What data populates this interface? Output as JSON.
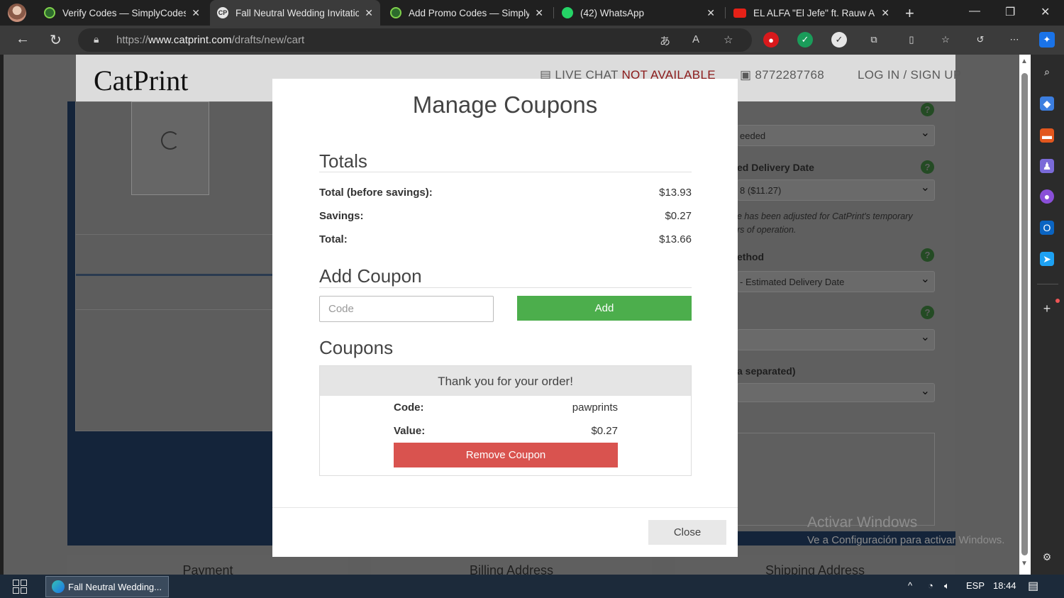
{
  "tabs": [
    {
      "title": "Verify Codes — SimplyCodes",
      "icon": "simplycodes-icon"
    },
    {
      "title": "Fall Neutral Wedding Invitatio",
      "icon": "catprint-icon"
    },
    {
      "title": "Add Promo Codes — SimplyC",
      "icon": "simplycodes-icon"
    },
    {
      "title": "(42) WhatsApp",
      "icon": "whatsapp-icon"
    },
    {
      "title": "EL ALFA \"El Jefe\" ft. Rauw Ale",
      "icon": "youtube-icon"
    }
  ],
  "address": {
    "prefix": "https://",
    "domain": "www.catprint.com",
    "path": "/drafts/new/cart"
  },
  "site": {
    "logo": "CatPrint",
    "live_chat": "LIVE CHAT",
    "not_available": "NOT AVAILABLE",
    "phone": "8772287768",
    "login": "LOG IN / SIGN UP"
  },
  "background_form": {
    "select1": "eeded",
    "label_delivery": "ed Delivery Date",
    "select2": "8 ($11.27)",
    "note_line1": "e has been adjusted for CatPrint's temporary",
    "note_line2": "rs of operation.",
    "label_method": "ethod",
    "select3": "- Estimated Delivery Date",
    "label_separated": "a separated)",
    "bottom_payment": "Payment",
    "bottom_billing": "Billing Address",
    "bottom_shipping": "Shipping Address"
  },
  "watermark": {
    "line1": "Activar Windows",
    "line2": "Ve a Configuración para activar Windows."
  },
  "modal": {
    "title": "Manage Coupons",
    "totals_heading": "Totals",
    "totals": [
      {
        "label": "Total (before savings):",
        "value": "$13.93"
      },
      {
        "label": "Savings:",
        "value": "$0.27"
      },
      {
        "label": "Total:",
        "value": "$13.66"
      }
    ],
    "add_heading": "Add Coupon",
    "code_placeholder": "Code",
    "add_label": "Add",
    "coupons_heading": "Coupons",
    "coupon_message": "Thank you for your order!",
    "coupon_code_label": "Code:",
    "coupon_code_value": "pawprints",
    "coupon_value_label": "Value:",
    "coupon_value_value": "$0.27",
    "remove_label": "Remove Coupon",
    "close_label": "Close"
  },
  "taskbar": {
    "app_label": "Fall Neutral Wedding...",
    "lang": "ESP",
    "time": "18:44"
  },
  "colors": {
    "add_green": "#4cae4c",
    "remove_red": "#d9534f",
    "overlay": "#5e5e5e"
  }
}
